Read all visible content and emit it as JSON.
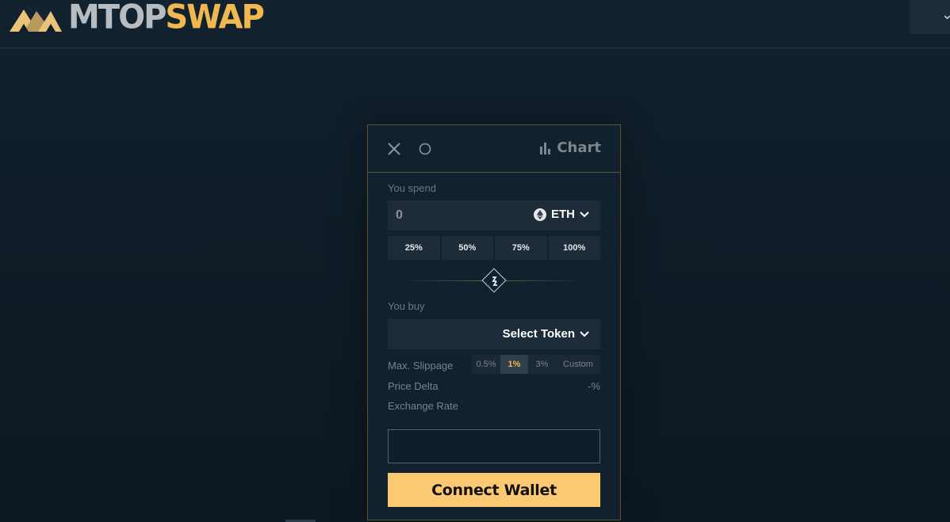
{
  "header": {
    "logo_text_a": "MTOP",
    "logo_text_b": "SWAP",
    "menu_icon": "chevron-down-icon"
  },
  "swap": {
    "close_icon": "close-icon",
    "refresh_icon": "refresh-icon",
    "chart_label": "Chart",
    "spend_label": "You spend",
    "spend_amount": "0",
    "spend_token": "ETH",
    "percent_buttons": [
      "25%",
      "50%",
      "75%",
      "100%"
    ],
    "buy_label": "You buy",
    "buy_token_placeholder": "Select Token",
    "max_slippage_label": "Max. Slippage",
    "slippage_options": [
      "0.5%",
      "1%",
      "3%",
      "Custom"
    ],
    "slippage_selected": "1%",
    "price_delta_label": "Price Delta",
    "price_delta_value": "-%",
    "exchange_rate_label": "Exchange Rate",
    "connect_wallet_label": "Connect Wallet"
  },
  "colors": {
    "accent": "#fcc973",
    "gold": "#f1b84f",
    "panel": "#11212d",
    "field": "#1d2c38"
  }
}
